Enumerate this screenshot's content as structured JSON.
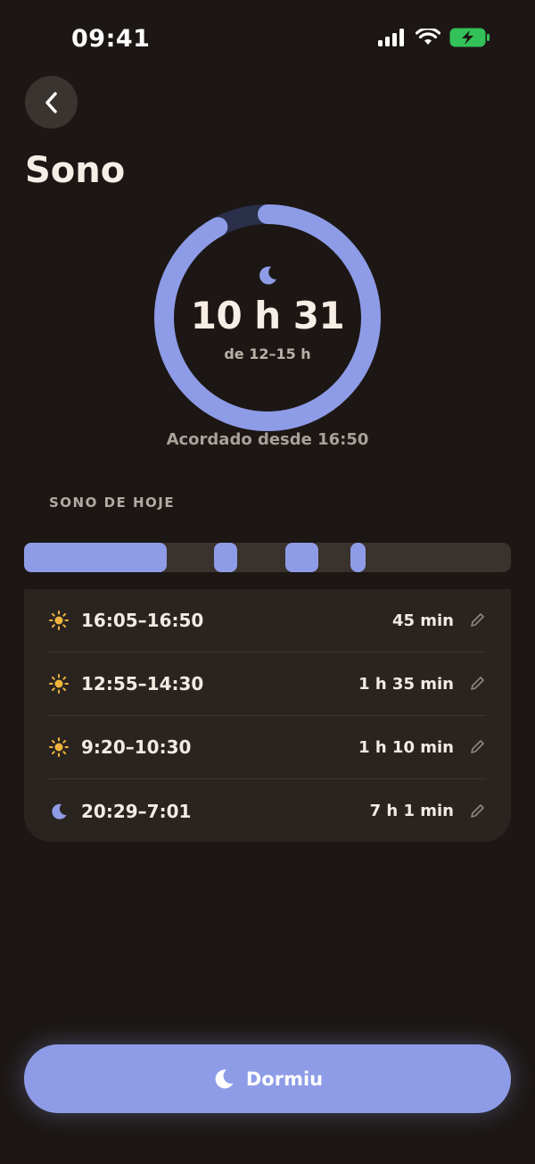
{
  "status_bar": {
    "time": "09:41"
  },
  "header": {
    "title": "Sono"
  },
  "summary": {
    "total": "10 h 31",
    "range": "de 12–15 h",
    "awake_since": "Acordado desde 16:50",
    "progress_fraction": 0.92
  },
  "today": {
    "section_label": "SONO DE HOJE",
    "sessions": [
      {
        "icon": "sun-icon",
        "time": "16:05–16:50",
        "duration": "45 min"
      },
      {
        "icon": "sun-icon",
        "time": "12:55–14:30",
        "duration": "1 h 35 min"
      },
      {
        "icon": "sun-icon",
        "time": "9:20–10:30",
        "duration": "1 h 10 min"
      },
      {
        "icon": "moon-icon",
        "time": "20:29–7:01",
        "duration": "7 h 1 min"
      }
    ]
  },
  "action": {
    "label": "Dormiu"
  },
  "colors": {
    "accent": "#8e9be6",
    "background": "#1c1714",
    "sun": "#f0b43c"
  }
}
